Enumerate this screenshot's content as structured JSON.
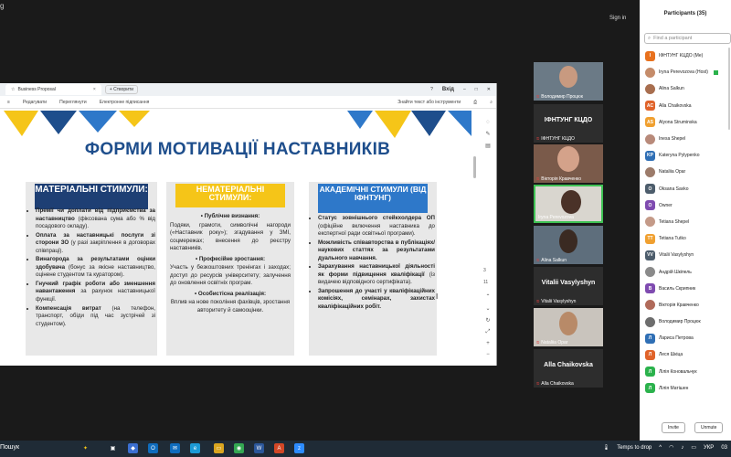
{
  "window": {
    "corner_mark": "g",
    "sign_in": "Sign in"
  },
  "browser": {
    "tab_title": "Business Proposal",
    "tab_close": "×",
    "new_tab": "+ Створити",
    "login_label": "Вхід",
    "toolbar": [
      "Редагувати",
      "Переглянути",
      "Електронне підписання"
    ],
    "find_placeholder": "Знайти текст або інструменти"
  },
  "slide": {
    "title": "ФОРМИ МОТИВАЦІЇ НАСТАВНИКІВ",
    "col1": {
      "heading": "МАТЕРІАЛЬНІ СТИМУЛИ:",
      "items": [
        {
          "bold": "Премії чи доплати від підприємства за наставництво",
          "rest": " (фіксована сума або % від посадового окладу)."
        },
        {
          "bold": "Оплата за наставницькі послуги зі сторони ЗО",
          "rest": " (у разі закріплення в договорах співпраці)."
        },
        {
          "bold": "Винагорода за результатами оцінки здобувача",
          "rest": " (бонус за якісне наставництво, оцінене студентом та куратором)."
        },
        {
          "bold": "Гнучкий графік роботи або зменшення навантаження",
          "rest": " за рахунок наставницької функції."
        },
        {
          "bold": "Компенсація витрат",
          "rest": " (на телефон, транспорт, обіди під час зустрічей зі студентом)."
        }
      ]
    },
    "col2": {
      "heading": "НЕМАТЕРІАЛЬНІ СТИМУЛИ:",
      "sections": [
        {
          "title": "Публічне визнання:",
          "text": "Подяки, грамоти, символічні нагороди («Наставник року»); згадування у ЗМІ, соцмережах; внесення до реєстру наставників."
        },
        {
          "title": "Професійне зростання:",
          "text": "Участь у безкоштовних тренінгах і заходах; доступ до ресурсів університету; залучення до оновлення освітніх програм."
        },
        {
          "title": "Особистісна реалізація:",
          "text": "Вплив на нове покоління фахівців, зростання авторитету й самооцінки."
        }
      ]
    },
    "col3": {
      "heading": "АКАДЕМІЧНІ СТИМУЛИ (ВІД ІФНТУНГ)",
      "items": [
        {
          "bold": "Статус зовнішнього стейкхолдера ОП",
          "rest": " (офіційне включення наставника до експертної ради освітньої програми)."
        },
        {
          "bold": "Можливість співавторства в публікаціях/наукових статтях за результатами дуального навчання.",
          "rest": ""
        },
        {
          "bold": "Зарахування наставницької діяльності як форми підвищення кваліфікації",
          "rest": " (із видачею відповідного сертифіката)."
        },
        {
          "bold": "Запрошення до участі у кваліфікаційних комісіях, семінарах, захистах кваліфікаційних робіт.",
          "rest": ""
        }
      ]
    }
  },
  "side": {
    "page_num": "3",
    "page_total": "11"
  },
  "tiles": [
    {
      "name": "Володимир Процюк",
      "top": 0
    },
    {
      "big": "ІФНТУНГ КЦДО",
      "name": "ІФНТУНГ КЦДО"
    },
    {
      "name": "Вікторія Кравченко"
    },
    {
      "name": "Iryna Perevozova"
    },
    {
      "name": "Alina Salkun"
    },
    {
      "big": "Vitalii Vasylyshyn",
      "name": "Vitalii Vasylyshyn"
    },
    {
      "name": "Nataliia Opar"
    },
    {
      "big": "Alla Chaikovska",
      "name": "Alla Chaikovska"
    }
  ],
  "participants": {
    "header": "Participants (35)",
    "search_placeholder": "Find a participant",
    "list": [
      {
        "initials": "І",
        "color": "#e8711e",
        "name": "ІФНТУНГ КЦДО (Me)"
      },
      {
        "initials": "",
        "color": "#c58c6a",
        "name": "Iryna Perevozova (Host)",
        "host": true
      },
      {
        "initials": "",
        "color": "#a86e4f",
        "name": "Alina Salkun"
      },
      {
        "initials": "AC",
        "color": "#e0632a",
        "name": "Alla Chaikovska"
      },
      {
        "initials": "AS",
        "color": "#f0a030",
        "name": "Alyona Struminska"
      },
      {
        "initials": "",
        "color": "#b88a7a",
        "name": "Inesa Shepel"
      },
      {
        "initials": "KP",
        "color": "#2f6fb5",
        "name": "Kateryna Pylypenko"
      },
      {
        "initials": "",
        "color": "#9c7b6a",
        "name": "Nataliia Opar"
      },
      {
        "initials": "O",
        "color": "#4d5d6c",
        "name": "Oksana Savko"
      },
      {
        "initials": "O",
        "color": "#7f4bb0",
        "name": "Owner"
      },
      {
        "initials": "",
        "color": "#c49a88",
        "name": "Tetiana Shepel"
      },
      {
        "initials": "TT",
        "color": "#f0a030",
        "name": "Tetiana Tutko"
      },
      {
        "initials": "VV",
        "color": "#4d5d6c",
        "name": "Vitalii Vasylyshyn"
      },
      {
        "initials": "",
        "color": "#8a8a8a",
        "name": "Андрій Шкіпель"
      },
      {
        "initials": "В",
        "color": "#7f4bb0",
        "name": "Василь Скрипник"
      },
      {
        "initials": "",
        "color": "#b06a5a",
        "name": "Вікторія Кравченко"
      },
      {
        "initials": "",
        "color": "#6d6d6d",
        "name": "Володимир Процюк"
      },
      {
        "initials": "Л",
        "color": "#2f6fb5",
        "name": "Лариса Петрова"
      },
      {
        "initials": "Л",
        "color": "#e0632a",
        "name": "Леся Шкіца"
      },
      {
        "initials": "Л",
        "color": "#2bb24c",
        "name": "Лілія Коновальчук"
      },
      {
        "initials": "Л",
        "color": "#2bb24c",
        "name": "Лілія Матішен"
      }
    ],
    "invite": "Invite",
    "unmute": "Unmute"
  },
  "taskbar": {
    "search": "Пошук",
    "drop": "Temps to drop",
    "lang": "УКР",
    "time": "03"
  }
}
